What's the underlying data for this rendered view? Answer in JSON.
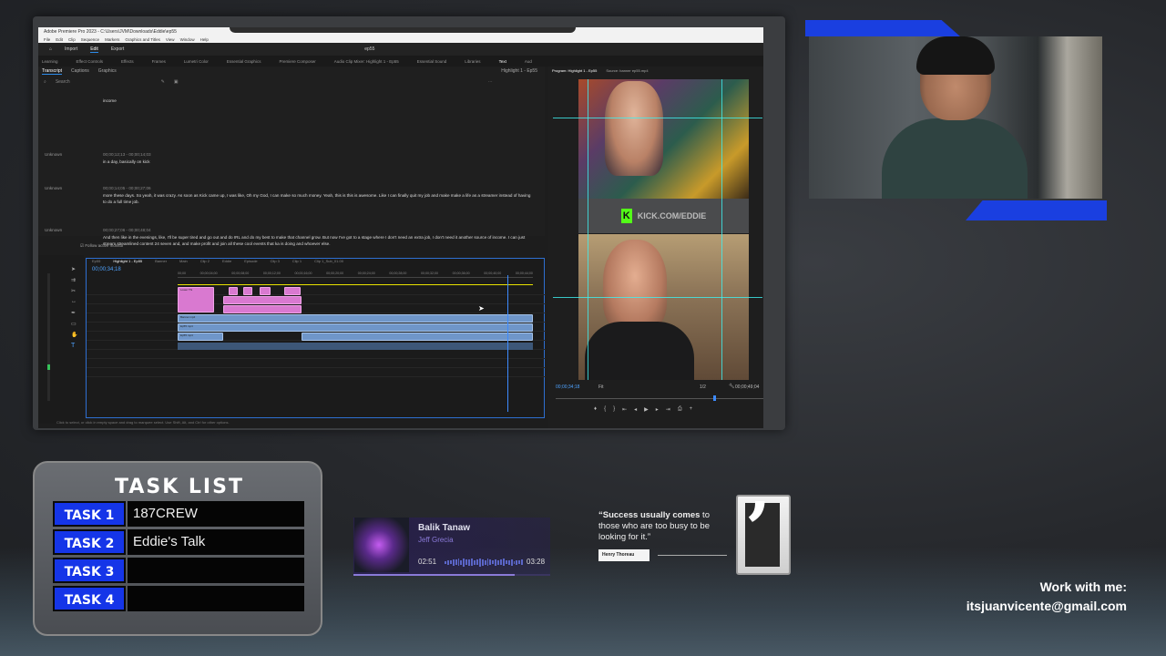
{
  "premiere": {
    "window_title": "Adobe Premiere Pro 2023 - C:\\Users\\JVM\\Downloads\\Eddie\\ep55",
    "menu": [
      "File",
      "Edit",
      "Clip",
      "Sequence",
      "Markers",
      "Graphics and Titles",
      "View",
      "Window",
      "Help"
    ],
    "modes": [
      "Import",
      "Edit",
      "Export"
    ],
    "active_mode": "Edit",
    "project_name": "ep55",
    "workspace_tabs": [
      "Learning",
      "Effect Controls",
      "Effects",
      "Frames",
      "Lumetri Color",
      "Essential Graphics",
      "Premiere Composer",
      "Audio Clip Mixer: Highlight 1 - Ep55",
      "Essential Sound",
      "Libraries",
      "Text",
      "Aud"
    ],
    "text_panel": {
      "tabs": [
        "Transcript",
        "Captions",
        "Graphics"
      ],
      "sequence_label": "Highlight 1 - Ep55",
      "search_placeholder": "Search",
      "first_line": "income",
      "entries": [
        {
          "speaker": "Unknown",
          "time": "00;00;12;13 - 00;00;14;03",
          "text": "in a day, basically on kick"
        },
        {
          "speaker": "Unknown",
          "time": "00;00;14;05 - 00;00;27;06",
          "text": "more these days. So yeah, it was crazy. As soon as Kick came up, I was like, Oh my God, I can make so much money. Yeah, this is this is awesome. Like I can finally quit my job and make make a life as a streamer instead of having to do a full time job."
        },
        {
          "speaker": "Unknown",
          "time": "00;00;27;06 - 00;00;48;04",
          "text": "And then like in the evenings, like, I'll be super tired and go out and do IRL and do my best to make that channel grow. But now I've got to a stage where I don't need an extra job, I don't need it another source of income. I can just stream streamlined content 24 seven and, and make profit and join all these cool events that ka is doing and whoever else."
        }
      ],
      "follow_label": "Follow active monitor"
    },
    "timeline": {
      "tabs": [
        "Ep55",
        "Highlight 1 - Ep55",
        "Banner",
        "Main",
        "Clip 2",
        "Eddie",
        "Episode",
        "Clip 3",
        "Clip 1",
        "Clip 1_Sub_01.00"
      ],
      "timecode": "00;00;34;18",
      "ruler": [
        "00;00",
        "00;00;04;00",
        "00;00;08;00",
        "00;00;12;00",
        "00;00;16;00",
        "00;00;20;00",
        "00;00;24;00",
        "00;00;28;00",
        "00;00;32;00",
        "00;00;36;00",
        "00;00;40;00",
        "00;00;44;00"
      ],
      "clip_labels": {
        "pink": "Lower Thi",
        "blue1": "Banner.mp4",
        "blue2": "Ep55.mp4",
        "blue3": "Ep55.mp4"
      }
    },
    "program": {
      "tab": "Program: Highlight 1 - Ep55",
      "source_tab": "Source: banner ep55.mp4",
      "overlay_text": "KICK.COM/EDDIE",
      "timecode_left": "00;00;34;18",
      "fit": "Fit",
      "ratio": "1/2",
      "timecode_right": "00;00;49;04",
      "playhead_fraction": 0.75
    },
    "status_hint": "Click to select, or click in empty space and drag to marquee select. Use Shift, Alt, and Ctrl for other options."
  },
  "task_list": {
    "title": "TASK LIST",
    "tasks": [
      {
        "label": "TASK 1",
        "value": "187CREW"
      },
      {
        "label": "TASK 2",
        "value": "Eddie's Talk"
      },
      {
        "label": "TASK 3",
        "value": ""
      },
      {
        "label": "TASK 4",
        "value": ""
      }
    ]
  },
  "music": {
    "title": "Balik Tanaw",
    "artist": "Jeff Grecia",
    "elapsed": "02:51",
    "duration": "03:28",
    "progress_fraction": 0.82
  },
  "quote": {
    "text_bold": "“Success usually comes",
    "text_rest": " to those who are too busy to be looking for it.”",
    "author": "Henry Thoreau",
    "glyph": "’"
  },
  "contact": {
    "line1": "Work with me:",
    "line2": "itsjuanvicente@gmail.com"
  },
  "colors": {
    "accent_blue": "#1a3fe0",
    "kick_green": "#53fc18",
    "premiere_blue": "#2d8ceb"
  }
}
